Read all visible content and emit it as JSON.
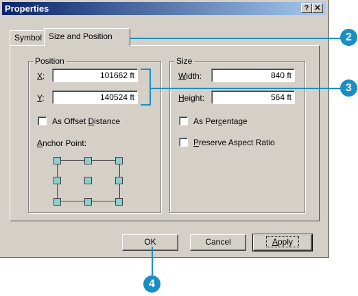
{
  "window": {
    "title": "Properties",
    "help_glyph": "?",
    "close_glyph": "✕"
  },
  "tabs": [
    {
      "label": "Symbol",
      "active": false
    },
    {
      "label": "Size and Position",
      "active": true
    }
  ],
  "position": {
    "legend": "Position",
    "x_label_key": "X",
    "x_label_rest": ":",
    "x_value": "101662 ft",
    "y_label_key": "Y",
    "y_label_rest": ":",
    "y_value": "140524 ft",
    "offset_label_pre": "As Offset ",
    "offset_label_key": "D",
    "offset_label_post": "istance",
    "offset_checked": false,
    "anchor_label_key": "A",
    "anchor_label_rest": "nchor Point:"
  },
  "size": {
    "legend": "Size",
    "width_label_key": "W",
    "width_label_rest": "idth:",
    "width_value": "840 ft",
    "height_label_key": "H",
    "height_label_rest": "eight:",
    "height_value": "564 ft",
    "percentage_label_pre": "As Per",
    "percentage_label_key": "c",
    "percentage_label_post": "entage",
    "percentage_checked": false,
    "aspect_label_key": "P",
    "aspect_label_rest": "reserve Aspect Ratio",
    "aspect_checked": false
  },
  "buttons": {
    "ok": "OK",
    "cancel": "Cancel",
    "apply_key": "A",
    "apply_rest": "pply"
  },
  "callouts": [
    "2",
    "3",
    "4"
  ],
  "colors": {
    "titlebar_start": "#0a246a",
    "titlebar_end": "#a6caf0",
    "dialog_face": "#d4d0c8",
    "anchor_fill": "#8ecece",
    "callout": "#1a8fc4"
  }
}
